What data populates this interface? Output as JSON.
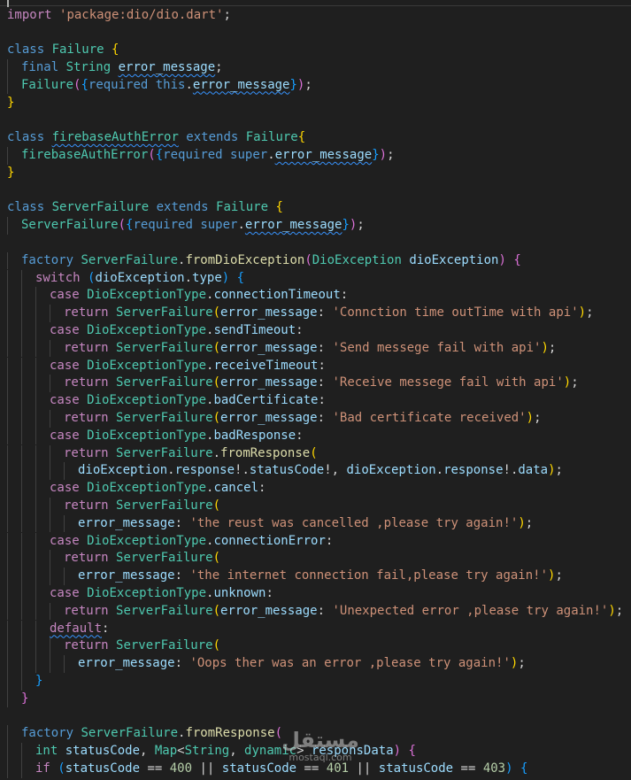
{
  "colors": {
    "background": "#1f1f1f",
    "keyword": "#569cd6",
    "control": "#c586c0",
    "type": "#4ec9b0",
    "function": "#dcdcaa",
    "variable": "#9cdcfe",
    "string": "#ce9178",
    "number": "#b5cea8",
    "punct": "#d4d4d4",
    "bracket1": "#ffd700",
    "bracket2": "#da70d6",
    "bracket3": "#179fff",
    "error_underline": "#3794ff"
  },
  "watermark": {
    "arabic": "مستقل",
    "latin": "mostaql.com"
  },
  "lines": [
    {
      "indent": 0,
      "tokens": [
        [
          "import ",
          "c"
        ],
        [
          "'package:dio/dio.dart'",
          "s"
        ],
        [
          ";",
          "p"
        ]
      ]
    },
    {
      "indent": 0,
      "tokens": []
    },
    {
      "indent": 0,
      "tokens": [
        [
          "class ",
          "k"
        ],
        [
          "Failure ",
          "t"
        ],
        [
          "{",
          "b1"
        ]
      ]
    },
    {
      "indent": 1,
      "tokens": [
        [
          "final ",
          "k"
        ],
        [
          "String ",
          "t"
        ],
        [
          "error_message",
          "v",
          "e"
        ],
        [
          ";",
          "p"
        ]
      ]
    },
    {
      "indent": 1,
      "tokens": [
        [
          "Failure",
          "t"
        ],
        [
          "(",
          "b2"
        ],
        [
          "{",
          "b3"
        ],
        [
          "required ",
          "k"
        ],
        [
          "this",
          "k"
        ],
        [
          ".",
          "p"
        ],
        [
          "error_message",
          "v",
          "e"
        ],
        [
          "}",
          "b3"
        ],
        [
          ")",
          "b2"
        ],
        [
          ";",
          "p"
        ]
      ]
    },
    {
      "indent": 0,
      "tokens": [
        [
          "}",
          "b1"
        ]
      ]
    },
    {
      "indent": 0,
      "tokens": []
    },
    {
      "indent": 0,
      "tokens": [
        [
          "class ",
          "k"
        ],
        [
          "firebaseAuthError",
          "t",
          "e"
        ],
        [
          " extends ",
          "k"
        ],
        [
          "Failure",
          "t"
        ],
        [
          "{",
          "b1"
        ]
      ]
    },
    {
      "indent": 1,
      "tokens": [
        [
          "firebaseAuthError",
          "t"
        ],
        [
          "(",
          "b2"
        ],
        [
          "{",
          "b3"
        ],
        [
          "required ",
          "k"
        ],
        [
          "super",
          "k"
        ],
        [
          ".",
          "p"
        ],
        [
          "error_message",
          "v",
          "e"
        ],
        [
          "}",
          "b3"
        ],
        [
          ")",
          "b2"
        ],
        [
          ";",
          "p"
        ]
      ]
    },
    {
      "indent": 0,
      "tokens": [
        [
          "}",
          "b1"
        ]
      ]
    },
    {
      "indent": 0,
      "tokens": []
    },
    {
      "indent": 0,
      "tokens": [
        [
          "class ",
          "k"
        ],
        [
          "ServerFailure ",
          "t"
        ],
        [
          "extends ",
          "k"
        ],
        [
          "Failure ",
          "t"
        ],
        [
          "{",
          "b1"
        ]
      ]
    },
    {
      "indent": 1,
      "tokens": [
        [
          "ServerFailure",
          "t"
        ],
        [
          "(",
          "b2"
        ],
        [
          "{",
          "b3"
        ],
        [
          "required ",
          "k"
        ],
        [
          "super",
          "k"
        ],
        [
          ".",
          "p"
        ],
        [
          "error_message",
          "v",
          "e"
        ],
        [
          "}",
          "b3"
        ],
        [
          ")",
          "b2"
        ],
        [
          ";",
          "p"
        ]
      ]
    },
    {
      "indent": 0,
      "tokens": []
    },
    {
      "indent": 1,
      "tokens": [
        [
          "factory ",
          "k"
        ],
        [
          "ServerFailure",
          "t"
        ],
        [
          ".",
          "p"
        ],
        [
          "fromDioException",
          "f"
        ],
        [
          "(",
          "b2"
        ],
        [
          "DioException ",
          "t"
        ],
        [
          "dioException",
          "v"
        ],
        [
          ") ",
          "b2"
        ],
        [
          "{",
          "b2"
        ]
      ]
    },
    {
      "indent": 2,
      "tokens": [
        [
          "switch ",
          "c"
        ],
        [
          "(",
          "b3"
        ],
        [
          "dioException",
          "v"
        ],
        [
          ".",
          "p"
        ],
        [
          "type",
          "v"
        ],
        [
          ") ",
          "b3"
        ],
        [
          "{",
          "b3"
        ]
      ]
    },
    {
      "indent": 3,
      "tokens": [
        [
          "case ",
          "c"
        ],
        [
          "DioExceptionType",
          "t"
        ],
        [
          ".",
          "p"
        ],
        [
          "connectionTimeout",
          "v"
        ],
        [
          ":",
          "p"
        ]
      ]
    },
    {
      "indent": 4,
      "tokens": [
        [
          "return ",
          "c"
        ],
        [
          "ServerFailure",
          "t"
        ],
        [
          "(",
          "b1"
        ],
        [
          "error_message",
          "v"
        ],
        [
          ": ",
          "p"
        ],
        [
          "'Connction time outTime with api'",
          "s"
        ],
        [
          ")",
          "b1"
        ],
        [
          ";",
          "p"
        ]
      ]
    },
    {
      "indent": 3,
      "tokens": [
        [
          "case ",
          "c"
        ],
        [
          "DioExceptionType",
          "t"
        ],
        [
          ".",
          "p"
        ],
        [
          "sendTimeout",
          "v"
        ],
        [
          ":",
          "p"
        ]
      ]
    },
    {
      "indent": 4,
      "tokens": [
        [
          "return ",
          "c"
        ],
        [
          "ServerFailure",
          "t"
        ],
        [
          "(",
          "b1"
        ],
        [
          "error_message",
          "v"
        ],
        [
          ": ",
          "p"
        ],
        [
          "'Send messege fail with api'",
          "s"
        ],
        [
          ")",
          "b1"
        ],
        [
          ";",
          "p"
        ]
      ]
    },
    {
      "indent": 3,
      "tokens": [
        [
          "case ",
          "c"
        ],
        [
          "DioExceptionType",
          "t"
        ],
        [
          ".",
          "p"
        ],
        [
          "receiveTimeout",
          "v"
        ],
        [
          ":",
          "p"
        ]
      ]
    },
    {
      "indent": 4,
      "tokens": [
        [
          "return ",
          "c"
        ],
        [
          "ServerFailure",
          "t"
        ],
        [
          "(",
          "b1"
        ],
        [
          "error_message",
          "v"
        ],
        [
          ": ",
          "p"
        ],
        [
          "'Receive messege fail with api'",
          "s"
        ],
        [
          ")",
          "b1"
        ],
        [
          ";",
          "p"
        ]
      ]
    },
    {
      "indent": 3,
      "tokens": [
        [
          "case ",
          "c"
        ],
        [
          "DioExceptionType",
          "t"
        ],
        [
          ".",
          "p"
        ],
        [
          "badCertificate",
          "v"
        ],
        [
          ":",
          "p"
        ]
      ]
    },
    {
      "indent": 4,
      "tokens": [
        [
          "return ",
          "c"
        ],
        [
          "ServerFailure",
          "t"
        ],
        [
          "(",
          "b1"
        ],
        [
          "error_message",
          "v"
        ],
        [
          ": ",
          "p"
        ],
        [
          "'Bad certificate received'",
          "s"
        ],
        [
          ")",
          "b1"
        ],
        [
          ";",
          "p"
        ]
      ]
    },
    {
      "indent": 3,
      "tokens": [
        [
          "case ",
          "c"
        ],
        [
          "DioExceptionType",
          "t"
        ],
        [
          ".",
          "p"
        ],
        [
          "badResponse",
          "v"
        ],
        [
          ":",
          "p"
        ]
      ]
    },
    {
      "indent": 4,
      "tokens": [
        [
          "return ",
          "c"
        ],
        [
          "ServerFailure",
          "t"
        ],
        [
          ".",
          "p"
        ],
        [
          "fromResponse",
          "f"
        ],
        [
          "(",
          "b1"
        ]
      ]
    },
    {
      "indent": 5,
      "tokens": [
        [
          "dioException",
          "v"
        ],
        [
          ".",
          "p"
        ],
        [
          "response",
          "v"
        ],
        [
          "!.",
          "p"
        ],
        [
          "statusCode",
          "v"
        ],
        [
          "!, ",
          "p"
        ],
        [
          "dioException",
          "v"
        ],
        [
          ".",
          "p"
        ],
        [
          "response",
          "v"
        ],
        [
          "!.",
          "p"
        ],
        [
          "data",
          "v"
        ],
        [
          ")",
          "b1"
        ],
        [
          ";",
          "p"
        ]
      ]
    },
    {
      "indent": 3,
      "tokens": [
        [
          "case ",
          "c"
        ],
        [
          "DioExceptionType",
          "t"
        ],
        [
          ".",
          "p"
        ],
        [
          "cancel",
          "v"
        ],
        [
          ":",
          "p"
        ]
      ]
    },
    {
      "indent": 4,
      "tokens": [
        [
          "return ",
          "c"
        ],
        [
          "ServerFailure",
          "t"
        ],
        [
          "(",
          "b1"
        ]
      ]
    },
    {
      "indent": 5,
      "tokens": [
        [
          "error_message",
          "v"
        ],
        [
          ": ",
          "p"
        ],
        [
          "'the reust was cancelled ,please try again!'",
          "s"
        ],
        [
          ")",
          "b1"
        ],
        [
          ";",
          "p"
        ]
      ]
    },
    {
      "indent": 3,
      "tokens": [
        [
          "case ",
          "c"
        ],
        [
          "DioExceptionType",
          "t"
        ],
        [
          ".",
          "p"
        ],
        [
          "connectionError",
          "v"
        ],
        [
          ":",
          "p"
        ]
      ]
    },
    {
      "indent": 4,
      "tokens": [
        [
          "return ",
          "c"
        ],
        [
          "ServerFailure",
          "t"
        ],
        [
          "(",
          "b1"
        ]
      ]
    },
    {
      "indent": 5,
      "tokens": [
        [
          "error_message",
          "v"
        ],
        [
          ": ",
          "p"
        ],
        [
          "'the internet connection fail,please try again!'",
          "s"
        ],
        [
          ")",
          "b1"
        ],
        [
          ";",
          "p"
        ]
      ]
    },
    {
      "indent": 3,
      "tokens": [
        [
          "case ",
          "c"
        ],
        [
          "DioExceptionType",
          "t"
        ],
        [
          ".",
          "p"
        ],
        [
          "unknown",
          "v"
        ],
        [
          ":",
          "p"
        ]
      ]
    },
    {
      "indent": 4,
      "tokens": [
        [
          "return ",
          "c"
        ],
        [
          "ServerFailure",
          "t"
        ],
        [
          "(",
          "b1"
        ],
        [
          "error_message",
          "v"
        ],
        [
          ": ",
          "p"
        ],
        [
          "'Unexpected error ,please try again!'",
          "s"
        ],
        [
          ")",
          "b1"
        ],
        [
          ";",
          "p"
        ]
      ]
    },
    {
      "indent": 3,
      "tokens": [
        [
          "default",
          "c",
          "e"
        ],
        [
          ":",
          "p"
        ]
      ]
    },
    {
      "indent": 4,
      "tokens": [
        [
          "return ",
          "c"
        ],
        [
          "ServerFailure",
          "t"
        ],
        [
          "(",
          "b1"
        ]
      ]
    },
    {
      "indent": 5,
      "tokens": [
        [
          "error_message",
          "v"
        ],
        [
          ": ",
          "p"
        ],
        [
          "'Oops ther was an error ,please try again!'",
          "s"
        ],
        [
          ")",
          "b1"
        ],
        [
          ";",
          "p"
        ]
      ]
    },
    {
      "indent": 2,
      "tokens": [
        [
          "}",
          "b3"
        ]
      ]
    },
    {
      "indent": 1,
      "tokens": [
        [
          "}",
          "b2"
        ]
      ]
    },
    {
      "indent": 0,
      "tokens": []
    },
    {
      "indent": 1,
      "tokens": [
        [
          "factory ",
          "k"
        ],
        [
          "ServerFailure",
          "t"
        ],
        [
          ".",
          "p"
        ],
        [
          "fromResponse",
          "f"
        ],
        [
          "(",
          "b2"
        ]
      ]
    },
    {
      "indent": 2,
      "tokens": [
        [
          "int ",
          "t"
        ],
        [
          "statusCode",
          "v"
        ],
        [
          ", ",
          "p"
        ],
        [
          "Map",
          "t"
        ],
        [
          "<",
          "p"
        ],
        [
          "String",
          "t"
        ],
        [
          ", ",
          "p"
        ],
        [
          "dynamic",
          "t"
        ],
        [
          "> ",
          "p"
        ],
        [
          "responsData",
          "v"
        ],
        [
          ") ",
          "b2"
        ],
        [
          "{",
          "b2"
        ]
      ]
    },
    {
      "indent": 2,
      "tokens": [
        [
          "if ",
          "c"
        ],
        [
          "(",
          "b3"
        ],
        [
          "statusCode ",
          "v"
        ],
        [
          "== ",
          "p"
        ],
        [
          "400",
          "n"
        ],
        [
          " || ",
          "p"
        ],
        [
          "statusCode ",
          "v"
        ],
        [
          "== ",
          "p"
        ],
        [
          "401",
          "n"
        ],
        [
          " || ",
          "p"
        ],
        [
          "statusCode ",
          "v"
        ],
        [
          "== ",
          "p"
        ],
        [
          "403",
          "n"
        ],
        [
          ") ",
          "b3"
        ],
        [
          "{",
          "b3"
        ]
      ]
    }
  ]
}
